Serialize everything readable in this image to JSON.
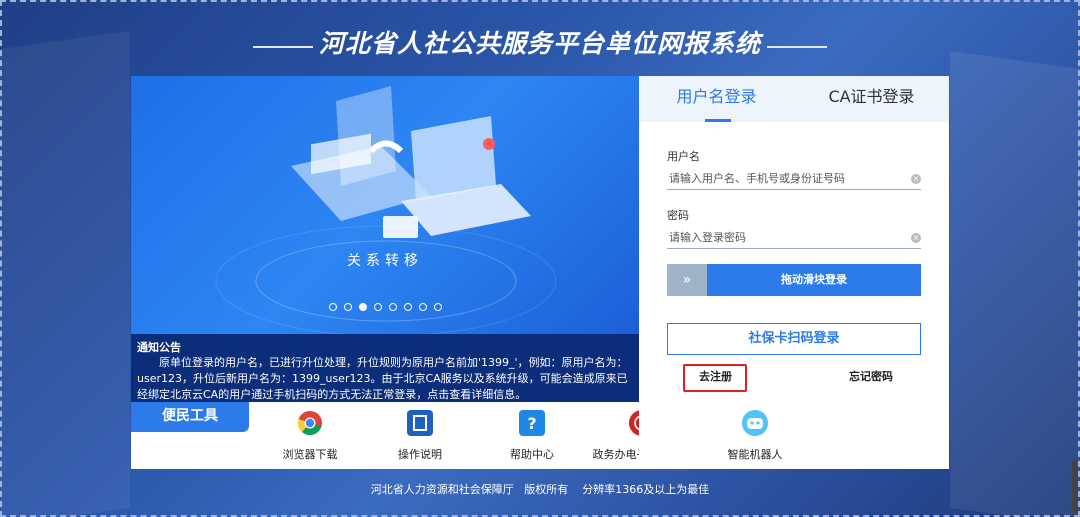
{
  "page": {
    "title": "河北省人社公共服务平台单位网报系统"
  },
  "banner": {
    "caption": "关系转移",
    "slide_count": 8,
    "active_slide": 3
  },
  "notice": {
    "title": "通知公告",
    "text": "原单位登录的用户名，已进行升位处理，升位规则为原用户名前加'1399_'，例如：原用户名为：user123，升位后新用户名为：1399_user123。由于北京CA服务以及系统升级，可能会造成原来已经绑定北京云CA的用户通过手机扫码的方式无法正常登录，点击查看详细信息。"
  },
  "tools": {
    "tab_label": "便民工具",
    "items": [
      {
        "label": "浏览器下载",
        "icon": "chrome-icon"
      },
      {
        "label": "操作说明",
        "icon": "book-icon"
      },
      {
        "label": "帮助中心",
        "icon": "help-icon"
      },
      {
        "label": "政务办电子印章申领",
        "icon": "seal-icon"
      },
      {
        "label": "智能机器人",
        "icon": "robot-icon"
      }
    ]
  },
  "login": {
    "tabs": [
      "用户名登录",
      "CA证书登录"
    ],
    "active_tab": 0,
    "username_label": "用户名",
    "username_placeholder": "请输入用户名、手机号或身份证号码",
    "password_label": "密码",
    "password_placeholder": "请输入登录密码",
    "slider_handle": "»",
    "slider_text": "拖动滑块登录",
    "qr_button": "社保卡扫码登录",
    "register_link": "去注册",
    "forgot_link": "忘记密码"
  },
  "footer": {
    "org": "河北省人力资源和社会保障厅",
    "copyright": "版权所有",
    "resolution": "分辨率1366及以上为最佳"
  },
  "colors": {
    "accent": "#2d7bea",
    "notice_bg": "#0b2d7a",
    "highlight_border": "#e02020"
  }
}
